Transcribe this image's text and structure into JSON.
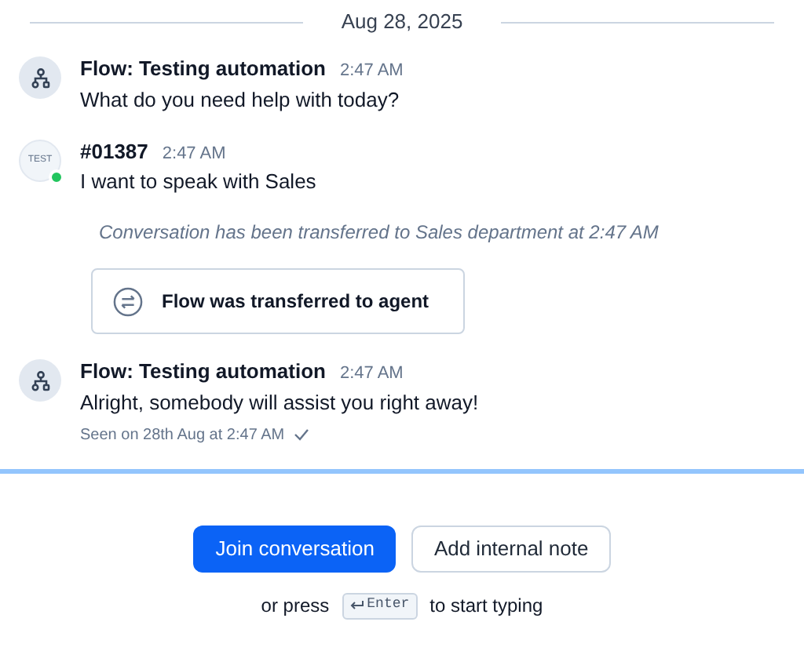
{
  "date_divider": "Aug 28, 2025",
  "messages": [
    {
      "kind": "message",
      "avatar": {
        "kind": "flow"
      },
      "sender": "Flow: Testing automation",
      "time": "2:47 AM",
      "text": "What do you need help with today?"
    },
    {
      "kind": "message",
      "avatar": {
        "kind": "contact",
        "text": "TEST"
      },
      "online": true,
      "sender": "#01387",
      "time": "2:47 AM",
      "text": "I want to speak with Sales"
    },
    {
      "kind": "system",
      "text": "Conversation has been transferred to Sales department at 2:47 AM"
    },
    {
      "kind": "event",
      "text": "Flow was transferred to agent"
    },
    {
      "kind": "message",
      "avatar": {
        "kind": "flow"
      },
      "sender": "Flow: Testing automation",
      "time": "2:47 AM",
      "text": "Alright, somebody will assist you right away!",
      "seen": "Seen on 28th Aug at 2:47 AM"
    }
  ],
  "composer": {
    "buttons": [
      {
        "label": "Join conversation",
        "primary": true
      },
      {
        "label": "Add internal note",
        "primary": false
      }
    ],
    "hint_before": "or press",
    "key": "Enter",
    "hint_after": "to start typing"
  }
}
